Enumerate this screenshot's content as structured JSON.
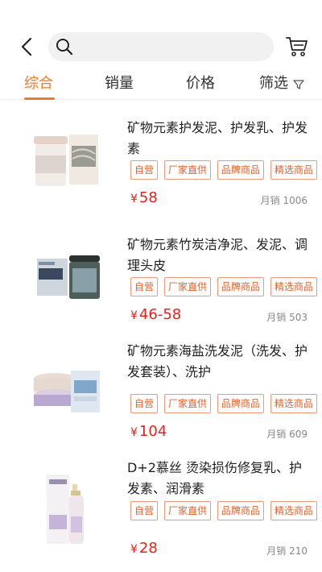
{
  "search": {
    "placeholder": "",
    "value": ""
  },
  "icons": {
    "back": "chevron-left-icon",
    "search": "search-icon",
    "cart": "cart-icon",
    "filter": "funnel-icon"
  },
  "colors": {
    "accent": "#f07a2b",
    "price": "#e8211c",
    "tag_border": "#f09a7a",
    "tag_text": "#e8602a"
  },
  "sort_tabs": [
    {
      "label": "综合",
      "active": true
    },
    {
      "label": "销量",
      "active": false
    },
    {
      "label": "价格",
      "active": false
    },
    {
      "label": "筛选",
      "active": false
    }
  ],
  "currency": "¥",
  "products": [
    {
      "title": "矿物元素护发泥、护发乳、护发素",
      "tags": [
        "自营",
        "厂家直供",
        "品牌商品",
        "精选商品"
      ],
      "price": "58",
      "sales": "月销 1006"
    },
    {
      "title": "矿物元素竹炭洁净泥、发泥、调理头皮",
      "tags": [
        "自营",
        "厂家直供",
        "品牌商品",
        "精选商品"
      ],
      "price": "46-58",
      "sales": "月销 503"
    },
    {
      "title": "矿物元素海盐洗发泥（洗发、护发套装）、洗护",
      "tags": [
        "自营",
        "厂家直供",
        "品牌商品",
        "精选商品"
      ],
      "price": "104",
      "sales": "月销 609"
    },
    {
      "title": "D+2慕丝 烫染损伤修复乳、护发素、润滑素",
      "tags": [
        "自营",
        "厂家直供",
        "品牌商品",
        "精选商品"
      ],
      "price": "28",
      "sales": "月销 210"
    }
  ]
}
